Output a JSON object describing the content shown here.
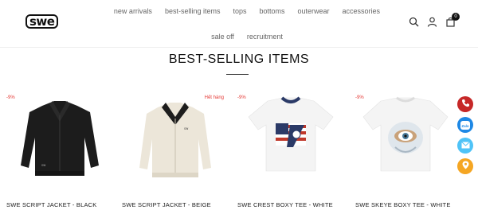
{
  "header": {
    "logo": "swe",
    "nav": [
      "new arrivals",
      "best-selling items",
      "tops",
      "bottoms",
      "outerwear",
      "accessories",
      "sale off",
      "recruitment"
    ],
    "icons": [
      "search-icon",
      "user-icon",
      "bag-icon"
    ],
    "cart_count": "0"
  },
  "section": {
    "title": "BEST-SELLING ITEMS"
  },
  "products": [
    {
      "name": "SWE SCRIPT JACKET - BLACK",
      "discount": "-9%",
      "status": ""
    },
    {
      "name": "SWE SCRIPT JACKET - BEIGE",
      "discount": "",
      "status": "Hết hàng"
    },
    {
      "name": "SWE CREST BOXY TEE - WHITE",
      "discount": "-9%",
      "status": ""
    },
    {
      "name": "SWE SKEYE BOXY TEE - WHITE",
      "discount": "-9%",
      "status": ""
    }
  ],
  "contact": {
    "buttons": [
      "phone-icon",
      "zalo-icon",
      "mail-icon",
      "location-icon"
    ],
    "zalo_label": "Zalo",
    "colors": {
      "phone": "#c62828",
      "zalo": "#1e88e5",
      "mail": "#4fc3f7",
      "location": "#f5a623"
    }
  },
  "colors": {
    "accent": "#e53935",
    "text": "#222222"
  }
}
